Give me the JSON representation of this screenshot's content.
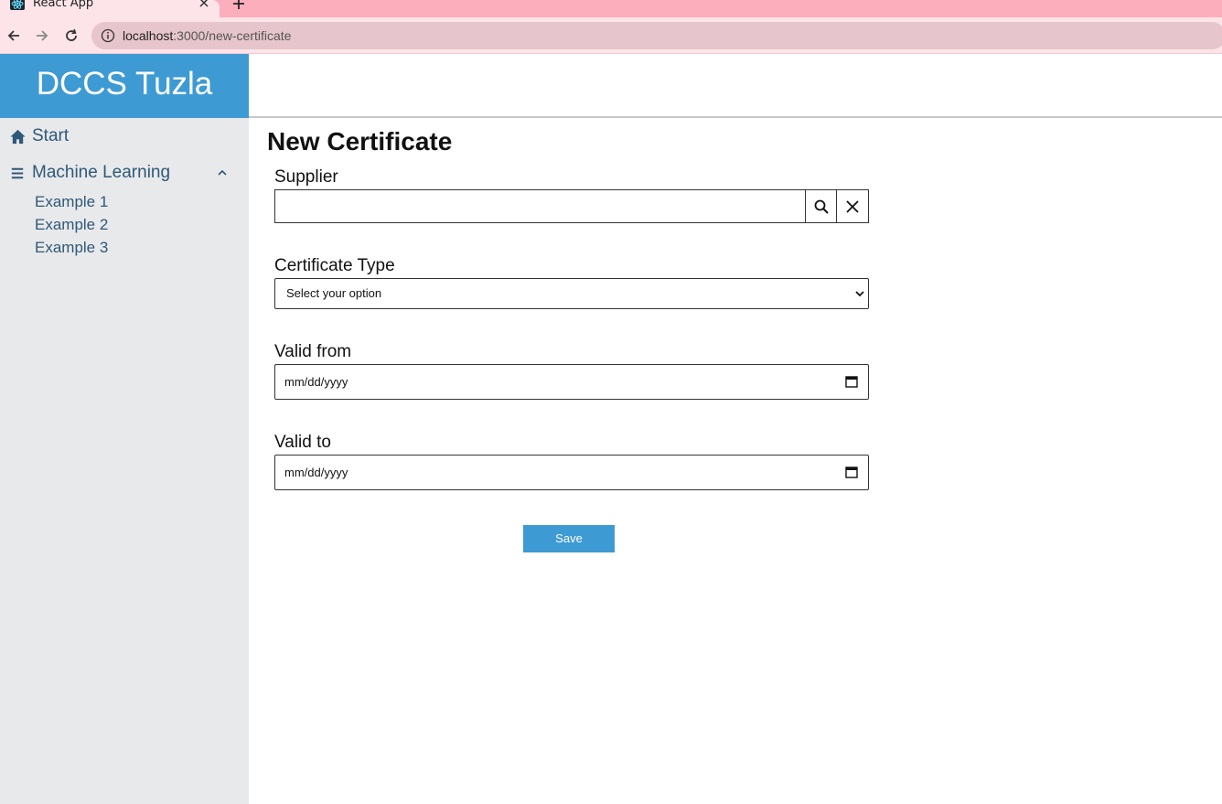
{
  "browser": {
    "tab_title": "React App",
    "url_host": "localhost",
    "url_path": ":3000/new-certificate",
    "tabstrip_color": "#fdaebc",
    "toolbar_color": "#fde4e9"
  },
  "sidebar": {
    "brand": "DCCS Tuzla",
    "brand_color": "#3e9ad3",
    "items": [
      {
        "label": "Start",
        "icon": "home-icon"
      },
      {
        "label": "Machine Learning",
        "icon": "menu-icon",
        "expanded": true,
        "children": [
          "Example 1",
          "Example 2",
          "Example 3"
        ]
      }
    ]
  },
  "main": {
    "title": "New Certificate",
    "form": {
      "supplier_label": "Supplier",
      "supplier_value": "",
      "certificate_type_label": "Certificate Type",
      "certificate_type_value": "Select your option",
      "valid_from_label": "Valid from",
      "valid_from_value": "mm/dd/yyyy",
      "valid_to_label": "Valid to",
      "valid_to_value": "mm/dd/yyyy",
      "save_label": "Save"
    }
  }
}
